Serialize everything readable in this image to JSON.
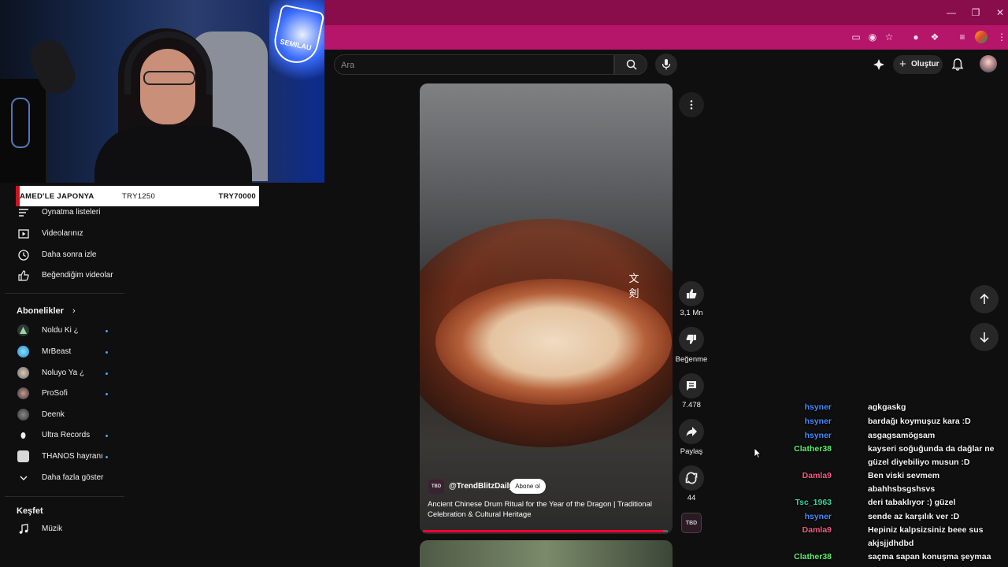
{
  "stream_banner": {
    "goal_title": "AMED'LE JAPONYA",
    "current": "TRY1250",
    "target": "TRY70000"
  },
  "webcam": {
    "logo_text": "SEMILAU"
  },
  "search": {
    "placeholder": "Ara"
  },
  "header": {
    "create_label": "Oluştur"
  },
  "sidebar": {
    "library_items": [
      {
        "label": "Oynatma listeleri",
        "icon": "playlist-icon"
      },
      {
        "label": "Videolarınız",
        "icon": "your-videos-icon"
      },
      {
        "label": "Daha sonra izle",
        "icon": "clock-icon"
      },
      {
        "label": "Beğendiğim videolar",
        "icon": "thumbs-up-icon"
      }
    ],
    "subscriptions_title": "Abonelikler",
    "subscriptions": [
      {
        "label": "Noldu Ki ¿",
        "new": true
      },
      {
        "label": "MrBeast",
        "new": true
      },
      {
        "label": "Noluyo Ya ¿",
        "new": true
      },
      {
        "label": "ProSofi",
        "new": true
      },
      {
        "label": "Deenk",
        "new": false
      },
      {
        "label": "Ultra Records",
        "new": true
      },
      {
        "label": "THANOS hayranı",
        "new": true
      }
    ],
    "show_more_label": "Daha fazla göster",
    "explore_title": "Keşfet",
    "explore_items": [
      {
        "label": "Müzik",
        "icon": "music-icon"
      }
    ]
  },
  "short": {
    "channel": "@TrendBlitzDaily",
    "channel_avatar_text": "TBD",
    "subscribe_label": "Abone ol",
    "title": "Ancient Chinese Drum Ritual for the Year of the Dragon | Traditional Celebration & Cultural Heritage",
    "watermark": "文\n剣",
    "progress": 0.98,
    "likes": "3,1 Mn",
    "dislike_label": "Beğenme",
    "comments": "7.478",
    "share_label": "Paylaş",
    "remix_count": "44",
    "sound_thumb_text": "TBD"
  },
  "chat": [
    {
      "user": "hsyner",
      "color": "#3f8cff",
      "message": "agkgaskg"
    },
    {
      "user": "hsyner",
      "color": "#3f8cff",
      "message": "bardağı koymuşuz kara :D"
    },
    {
      "user": "hsyner",
      "color": "#3f8cff",
      "message": "asgagsamögsam"
    },
    {
      "user": "Clather38",
      "color": "#5cf06e",
      "message": "kayseri soğuğunda da dağlar ne güzel diyebiliyo musun :D"
    },
    {
      "user": "Damla9",
      "color": "#f05a88",
      "message": "Ben viski sevmem abahhsbsgshsvs"
    },
    {
      "user": "Tsc_1963",
      "color": "#2fd6a0",
      "message": "deri tabaklıyor :) güzel"
    },
    {
      "user": "hsyner",
      "color": "#3f8cff",
      "message": "sende az karşılık ver :D"
    },
    {
      "user": "Damla9",
      "color": "#f05a88",
      "message": "Hepiniz kalpsizsiniz beee sus akjsjjdhdbd"
    },
    {
      "user": "Clather38",
      "color": "#5cf06e",
      "message": "saçma sapan konuşma şeymaa"
    }
  ]
}
